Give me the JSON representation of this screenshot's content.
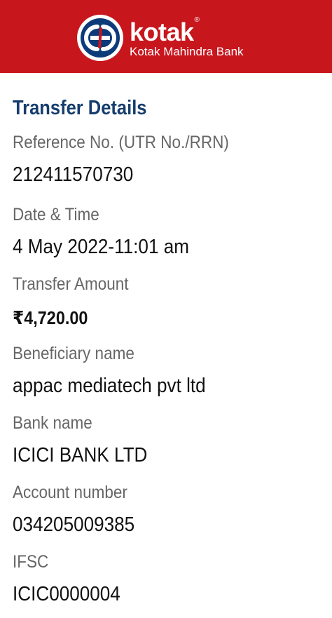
{
  "header": {
    "brand": "kotak",
    "registered_mark": "®",
    "bank_name": "Kotak Mahindra Bank",
    "background_color": "#c8161d",
    "logo_icon": "kotak-logo-icon"
  },
  "transfer": {
    "title": "Transfer Details",
    "fields": [
      {
        "label": "Reference No. (UTR No./RRN)",
        "value": "212411570730"
      },
      {
        "label": "Date & Time",
        "value": "4 May 2022-11:01 am"
      },
      {
        "label": "Transfer Amount",
        "value": "₹4,720.00"
      },
      {
        "label": "Beneficiary name",
        "value": "appac mediatech pvt ltd"
      },
      {
        "label": "Bank name",
        "value": "ICICI BANK LTD"
      },
      {
        "label": "Account number",
        "value": "034205009385"
      },
      {
        "label": "IFSC",
        "value": "ICIC0000004"
      }
    ]
  },
  "colors": {
    "title": "#163d6e",
    "label": "#666666",
    "value": "#111111"
  }
}
